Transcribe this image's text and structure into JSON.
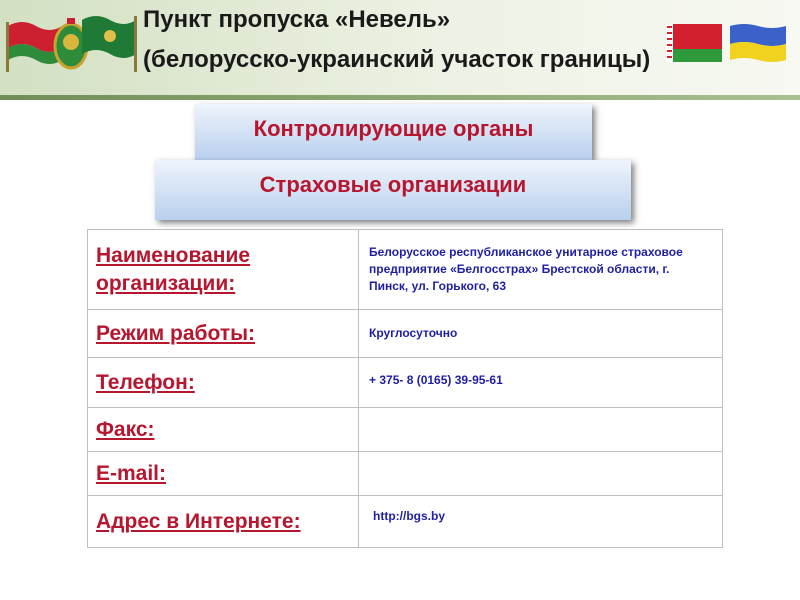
{
  "header": {
    "title": "Пункт пропуска «Невель»",
    "subtitle": "(белорусско-украинский участок границы)"
  },
  "boxes": {
    "control_label": "Контролирующие органы",
    "insurance_label": "Страховые организации"
  },
  "table": {
    "rows": [
      {
        "label": "Наименование организации:",
        "value": "Белорусское республиканское унитарное страховое предприятие «Белгосстрах» Брестской области, г. Пинск, ул. Горького, 63"
      },
      {
        "label": "Режим работы:",
        "value": "Круглосуточно"
      },
      {
        "label": "Телефон:",
        "value": "+ 375- 8 (0165) 39-95-61"
      },
      {
        "label": "Факс:",
        "value": ""
      },
      {
        "label": "E-mail:",
        "value": ""
      },
      {
        "label": "Адрес в Интернете:",
        "value": "http://bgs.by"
      }
    ]
  },
  "colors": {
    "label_red": "#b7162f",
    "value_blue": "#1f1fa6",
    "header_green": "#6f8f57"
  },
  "icons": [
    "belarus-flags-emblem-icon",
    "belarus-flag-icon",
    "ukraine-flag-icon"
  ]
}
